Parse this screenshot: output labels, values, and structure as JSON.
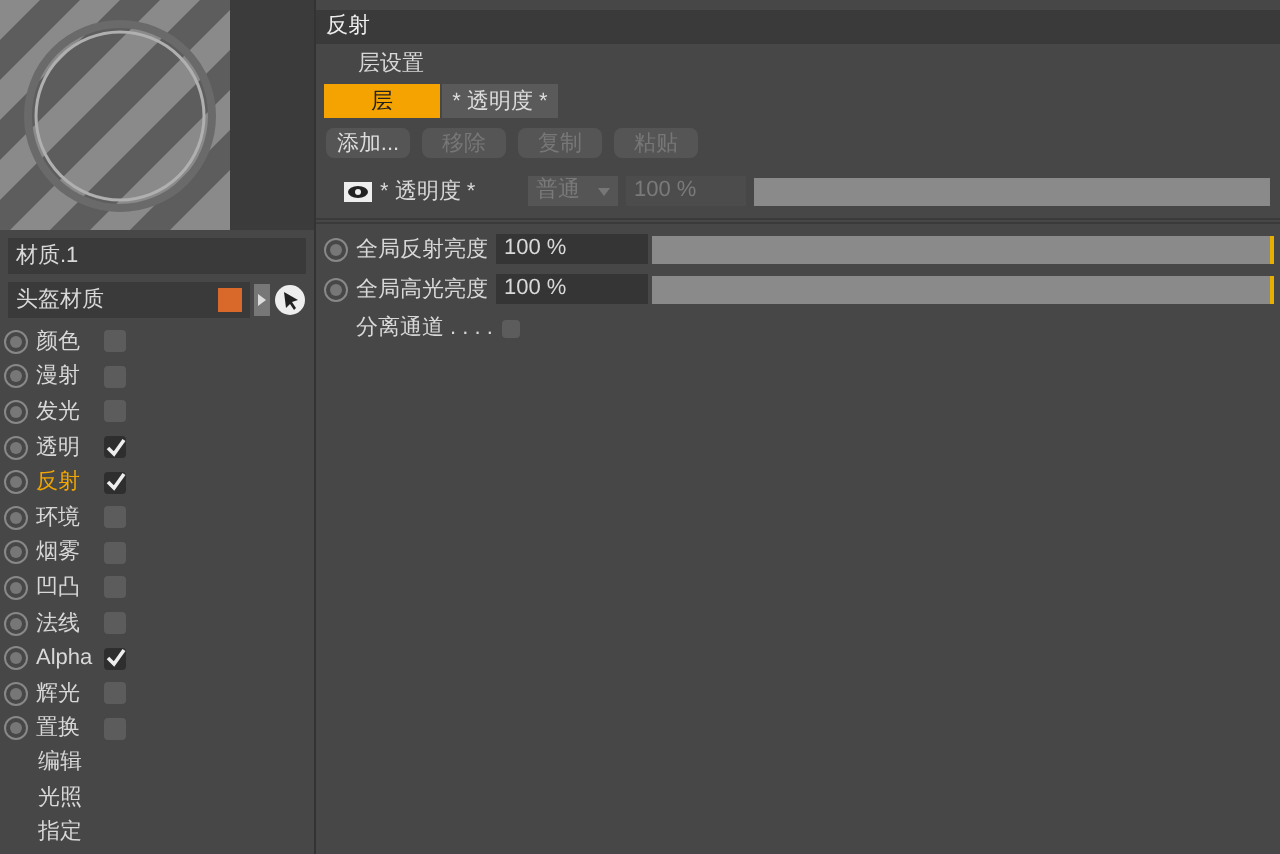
{
  "material": {
    "name": "材质.1",
    "tag": "头盔材质"
  },
  "channels": [
    {
      "label": "颜色",
      "checked": false,
      "selected": false
    },
    {
      "label": "漫射",
      "checked": false,
      "selected": false
    },
    {
      "label": "发光",
      "checked": false,
      "selected": false
    },
    {
      "label": "透明",
      "checked": true,
      "selected": false
    },
    {
      "label": "反射",
      "checked": true,
      "selected": true
    },
    {
      "label": "环境",
      "checked": false,
      "selected": false
    },
    {
      "label": "烟雾",
      "checked": false,
      "selected": false
    },
    {
      "label": "凹凸",
      "checked": false,
      "selected": false
    },
    {
      "label": "法线",
      "checked": false,
      "selected": false
    },
    {
      "label": "Alpha",
      "checked": true,
      "selected": false
    },
    {
      "label": "辉光",
      "checked": false,
      "selected": false
    },
    {
      "label": "置换",
      "checked": false,
      "selected": false
    }
  ],
  "extra_items": [
    "编辑",
    "光照",
    "指定"
  ],
  "panel": {
    "title": "反射",
    "section": "层设置",
    "tabs": [
      {
        "label": "层",
        "selected": true
      },
      {
        "label": "* 透明度 *",
        "selected": false
      }
    ],
    "buttons": [
      {
        "label": "添加...",
        "disabled": false
      },
      {
        "label": "移除",
        "disabled": true
      },
      {
        "label": "复制",
        "disabled": true
      },
      {
        "label": "粘贴",
        "disabled": true
      }
    ],
    "layer": {
      "label": "* 透明度 *",
      "mode": "普通",
      "value": "100 %",
      "disabled": true,
      "level": 1
    },
    "sliders": [
      {
        "label": "全局反射亮度",
        "value": "100 %",
        "level": 1
      },
      {
        "label": "全局高光亮度",
        "value": "100 %",
        "level": 1
      }
    ],
    "separate": {
      "label": "分离通道 . . . .",
      "checked": false
    }
  }
}
